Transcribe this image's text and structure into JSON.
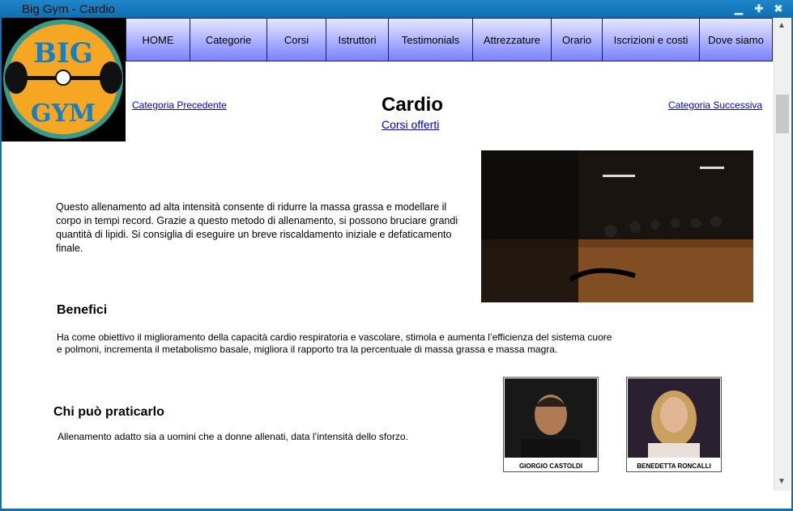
{
  "window": {
    "title": "Big Gym - Cardio",
    "minimize_icon": "minimize-icon",
    "maximize_icon": "maximize-icon",
    "close_icon": "close-icon"
  },
  "nav": {
    "items": [
      {
        "label": "HOME"
      },
      {
        "label": "Categorie"
      },
      {
        "label": "Corsi"
      },
      {
        "label": "Istruttori"
      },
      {
        "label": "Testimonials"
      },
      {
        "label": "Attrezzature"
      },
      {
        "label": "Orario"
      },
      {
        "label": "Iscrizioni e costi"
      },
      {
        "label": "Dove siamo"
      }
    ]
  },
  "page": {
    "prev_link": "Categoria Precedente",
    "next_link": "Categoria Successiva",
    "title": "Cardio",
    "courses_link": "Corsi offerti",
    "intro": "Questo allenamento ad alta intensità consente di ridurre la massa grassa e modellare il corpo in tempi record. Grazie a questo metodo di allenamento, si possono bruciare grandi quantità di lipidi. Si consiglia di eseguire un breve riscaldamento iniziale e defaticamento finale.",
    "benefits_title": "Benefici",
    "benefits_text": "Ha come obiettivo il miglioramento della capacità cardio respiratoria e vascolare, stimola e aumenta l’efficienza del sistema cuore e polmoni, incrementa il metabolismo basale, migliora il rapporto tra la percentuale di massa grassa e massa magra.",
    "who_title": "Chi può praticarlo",
    "who_text": "Allenamento adatto sia a uomini che a donne allenati, data l’intensità dello sforzo.",
    "instructors": [
      {
        "name": "GIORGIO CASTOLDI"
      },
      {
        "name": "BENEDETTA RONCALLI"
      }
    ]
  },
  "logo": {
    "text_top": "BIG",
    "text_bottom": "GYM",
    "colors": {
      "ring": "#f5a623",
      "text": "#1a7fc1"
    }
  }
}
